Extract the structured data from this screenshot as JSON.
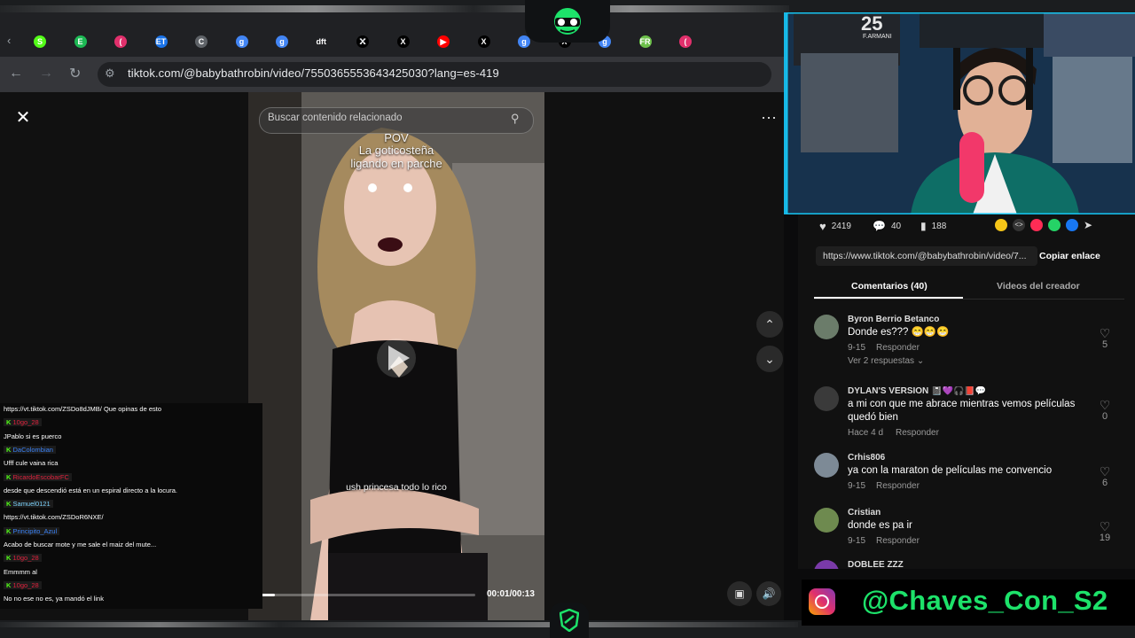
{
  "browser": {
    "tabs": [
      {
        "icon": "kick-icon",
        "color": "#53fc18",
        "text": "S"
      },
      {
        "icon": "spotify-icon",
        "color": "#1db954",
        "text": "E"
      },
      {
        "icon": "instagram-icon",
        "color": "#e1306c",
        "text": "("
      },
      {
        "icon": "et-icon",
        "color": "#1a73e8",
        "text": "ET"
      },
      {
        "icon": "globe-icon",
        "color": "#5f6368",
        "text": "C"
      },
      {
        "icon": "google-icon",
        "color": "#4285f4",
        "text": "g"
      },
      {
        "icon": "google-icon",
        "color": "#4285f4",
        "text": "g"
      },
      {
        "icon": "dft-icon",
        "color": "#3c4043",
        "text": "dft"
      },
      {
        "icon": "x-icon",
        "color": "#000000",
        "text": "X"
      },
      {
        "icon": "x-icon",
        "color": "#000000",
        "text": "X"
      },
      {
        "icon": "youtube-icon",
        "color": "#ff0000",
        "text": "▶"
      },
      {
        "icon": "x-icon",
        "color": "#000000",
        "text": "X"
      },
      {
        "icon": "google-icon",
        "color": "#4285f4",
        "text": "g"
      },
      {
        "icon": "x-icon",
        "color": "#000000",
        "text": "X"
      },
      {
        "icon": "google-icon",
        "color": "#4285f4",
        "text": "g"
      },
      {
        "icon": "fr-icon",
        "color": "#6cc04a",
        "text": "FR"
      },
      {
        "icon": "instagram-icon",
        "color": "#e1306c",
        "text": "("
      }
    ],
    "url": "tiktok.com/@babybathrobin/video/7550365553643425030?lang=es-419"
  },
  "video": {
    "search_placeholder": "Buscar contenido relacionado",
    "overlay_title": "POV",
    "overlay_line1": "La goticosteña",
    "overlay_line2": "ligando en parche",
    "caption": "ush princesa todo lo rico",
    "timecode": "00:01/00:13",
    "progress": 0.08
  },
  "stats": {
    "likes": "2419",
    "comments": "40",
    "saves": "188"
  },
  "share": {
    "link": "https://www.tiktok.com/@babybathrobin/video/7...",
    "copy_label": "Copiar enlace"
  },
  "tabs": {
    "comments": "Comentarios (40)",
    "videos": "Videos del creador"
  },
  "comments": [
    {
      "name": "Byron Berrio Betanco",
      "text": "Donde es??? 😁😁😁",
      "date": "9-15",
      "reply": "Responder",
      "likes": "5",
      "more": "Ver 2 respuestas",
      "avatar": "#6b7c6a"
    },
    {
      "name": "DYLAN'S VERSION 📓💜🎧📕💬",
      "text": "a mi con que me abrace mientras vemos películas quedó bien",
      "date": "Hace 4 d",
      "reply": "Responder",
      "likes": "0",
      "more": "",
      "avatar": "#3a3a3a"
    },
    {
      "name": "Crhis806",
      "text": "ya con la maraton de películas me convencio",
      "date": "9-15",
      "reply": "Responder",
      "likes": "6",
      "more": "",
      "avatar": "#7d8a96"
    },
    {
      "name": "Cristian",
      "text": "donde es pa ir",
      "date": "9-15",
      "reply": "Responder",
      "likes": "19",
      "more": "",
      "avatar": "#6e8a4f"
    },
    {
      "name": "DOBLEE ZZZ",
      "text": "",
      "date": "",
      "reply": "",
      "likes": "",
      "more": "",
      "avatar": "#7a3aa8"
    }
  ],
  "chat": [
    {
      "type": "msg",
      "text": "https://vt.tiktok.com/ZSDo8dJMB/ Que opinas de esto"
    },
    {
      "type": "user",
      "text": "10go_28",
      "color": "#e0223d"
    },
    {
      "type": "msg",
      "text": "JPablo si es puerco"
    },
    {
      "type": "user",
      "text": "DaColombian",
      "color": "#3b82f6"
    },
    {
      "type": "msg",
      "text": "Ufff cule vaina rica"
    },
    {
      "type": "user",
      "text": "RicardoEscobarFC",
      "color": "#e0223d"
    },
    {
      "type": "msg",
      "text": "desde que descendió está en un espiral directo a la locura."
    },
    {
      "type": "user",
      "text": "Samuel0121",
      "color": "#7dd3fc"
    },
    {
      "type": "msg",
      "text": "https://vt.tiktok.com/ZSDoR6NXE/"
    },
    {
      "type": "user",
      "text": "Principito_Azul",
      "color": "#3b82f6"
    },
    {
      "type": "msg",
      "text": "Acabo de buscar mote y me sale el maiz del mute..."
    },
    {
      "type": "user",
      "text": "10go_28",
      "color": "#e0223d"
    },
    {
      "type": "msg",
      "text": "Emmmm al"
    },
    {
      "type": "user",
      "text": "10go_28",
      "color": "#e0223d"
    },
    {
      "type": "msg",
      "text": "No no ese no es, ya mandó el link"
    }
  ],
  "stream": {
    "handle": "@Chaves_Con_S2",
    "accent": "#1de26a",
    "jersey_number": "25",
    "jersey_name": "F.ARMANI"
  }
}
